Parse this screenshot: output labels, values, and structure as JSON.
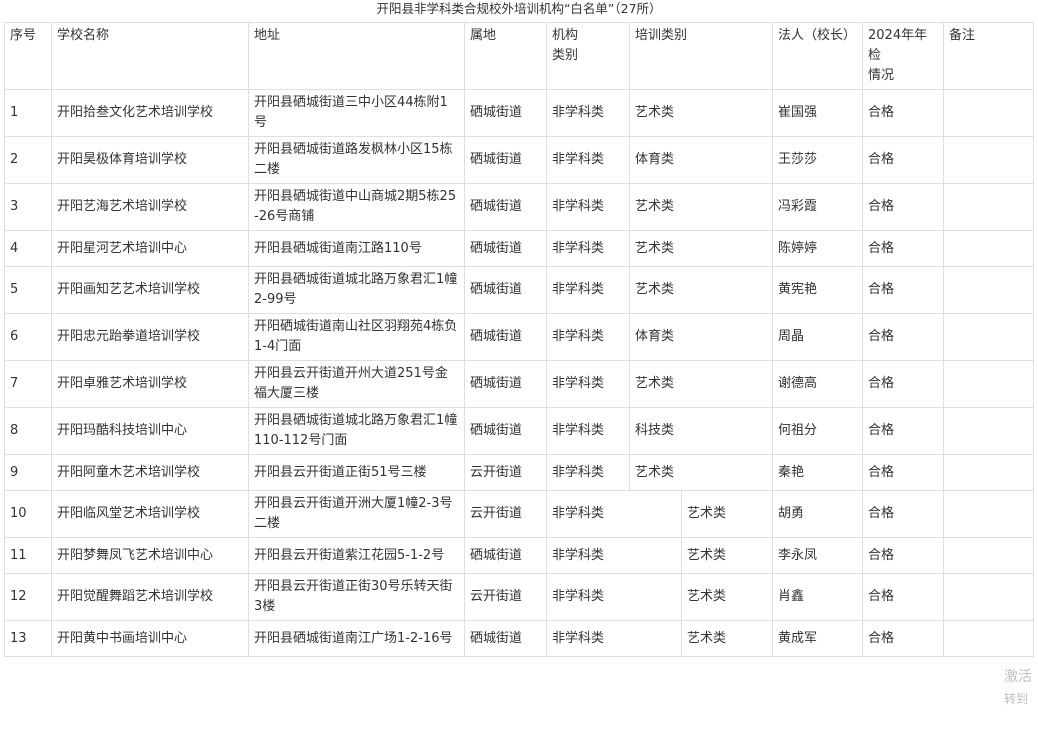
{
  "title": "开阳县非学科类合规校外培训机构“白名单”（27所）",
  "columns": {
    "no": "序号",
    "name": "学校名称",
    "address": "地址",
    "district": "属地",
    "inst_type_line1": "机构",
    "inst_type_line2": "类别",
    "train_type": "培训类别",
    "legal": "法人（校长）",
    "inspect_line1": "2024年年检",
    "inspect_line2": "情况",
    "remark": "备注"
  },
  "rows": [
    {
      "no": "1",
      "name": "开阳拾叁文化艺术培训学校",
      "address": "开阳县硒城街道三中小区44栋附1号",
      "district": "硒城街道",
      "inst_type": "非学科类",
      "train_type": "艺术类",
      "legal": "崔国强",
      "inspect": "合格",
      "remark": "",
      "layout": "a"
    },
    {
      "no": "2",
      "name": "开阳昊极体育培训学校",
      "address": "开阳县硒城街道路发枫林小区15栋二楼",
      "district": "硒城街道",
      "inst_type": "非学科类",
      "train_type": "体育类",
      "legal": "王莎莎",
      "inspect": "合格",
      "remark": "",
      "layout": "a"
    },
    {
      "no": "3",
      "name": "开阳艺海艺术培训学校",
      "address": "开阳县硒城街道中山商城2期5栋25-26号商铺",
      "district": "硒城街道",
      "inst_type": "非学科类",
      "train_type": "艺术类",
      "legal": "冯彩霞",
      "inspect": "合格",
      "remark": "",
      "layout": "a"
    },
    {
      "no": "4",
      "name": "开阳星河艺术培训中心",
      "address": "开阳县硒城街道南江路110号",
      "district": "硒城街道",
      "inst_type": "非学科类",
      "train_type": "艺术类",
      "legal": "陈婷婷",
      "inspect": "合格",
      "remark": "",
      "layout": "a"
    },
    {
      "no": "5",
      "name": "开阳画知艺艺术培训学校",
      "address": "开阳县硒城街道城北路万象君汇1幢2-99号",
      "district": "硒城街道",
      "inst_type": "非学科类",
      "train_type": "艺术类",
      "legal": "黄宪艳",
      "inspect": "合格",
      "remark": "",
      "layout": "a"
    },
    {
      "no": "6",
      "name": "开阳忠元跆拳道培训学校",
      "address": "开阳硒城街道南山社区羽翔苑4栋负1-4门面",
      "district": "硒城街道",
      "inst_type": "非学科类",
      "train_type": "体育类",
      "legal": "周晶",
      "inspect": "合格",
      "remark": "",
      "layout": "a"
    },
    {
      "no": "7",
      "name": "开阳卓雅艺术培训学校",
      "address": "开阳县云开街道开州大道251号金福大厦三楼",
      "district": "硒城街道",
      "inst_type": "非学科类",
      "train_type": "艺术类",
      "legal": "谢德高",
      "inspect": "合格",
      "remark": "",
      "layout": "a"
    },
    {
      "no": "8",
      "name": "开阳玛酷科技培训中心",
      "address": "开阳县硒城街道城北路万象君汇1幢110-112号门面",
      "district": "硒城街道",
      "inst_type": "非学科类",
      "train_type": "科技类",
      "legal": "何祖分",
      "inspect": "合格",
      "remark": "",
      "layout": "a"
    },
    {
      "no": "9",
      "name": "开阳阿童木艺术培训学校",
      "address": "开阳县云开街道正街51号三楼",
      "district": "云开街道",
      "inst_type": "非学科类",
      "train_type": "艺术类",
      "legal": "秦艳",
      "inspect": "合格",
      "remark": "",
      "layout": "a"
    },
    {
      "no": "10",
      "name": "开阳临风堂艺术培训学校",
      "address": "开阳县云开街道开洲大厦1幢2-3号二楼",
      "district": "云开街道",
      "inst_type": "非学科类",
      "train_type": "艺术类",
      "legal": "胡勇",
      "inspect": "合格",
      "remark": "",
      "layout": "b"
    },
    {
      "no": "11",
      "name": "开阳梦舞凤飞艺术培训中心",
      "address": "开阳县云开街道紫江花园5-1-2号",
      "district": "硒城街道",
      "inst_type": "非学科类",
      "train_type": "艺术类",
      "legal": "李永凤",
      "inspect": "合格",
      "remark": "",
      "layout": "b"
    },
    {
      "no": "12",
      "name": "开阳觉醒舞蹈艺术培训学校",
      "address": "开阳县云开街道正街30号乐转天街3楼",
      "district": "云开街道",
      "inst_type": "非学科类",
      "train_type": "艺术类",
      "legal": "肖鑫",
      "inspect": "合格",
      "remark": "",
      "layout": "b"
    },
    {
      "no": "13",
      "name": "开阳黄中书画培训中心",
      "address": "开阳县硒城街道南江广场1-2-16号",
      "district": "硒城街道",
      "inst_type": "非学科类",
      "train_type": "艺术类",
      "legal": "黄成军",
      "inspect": "合格",
      "remark": "",
      "layout": "b"
    }
  ],
  "watermark": {
    "line1": "激活",
    "line2": "转到"
  }
}
